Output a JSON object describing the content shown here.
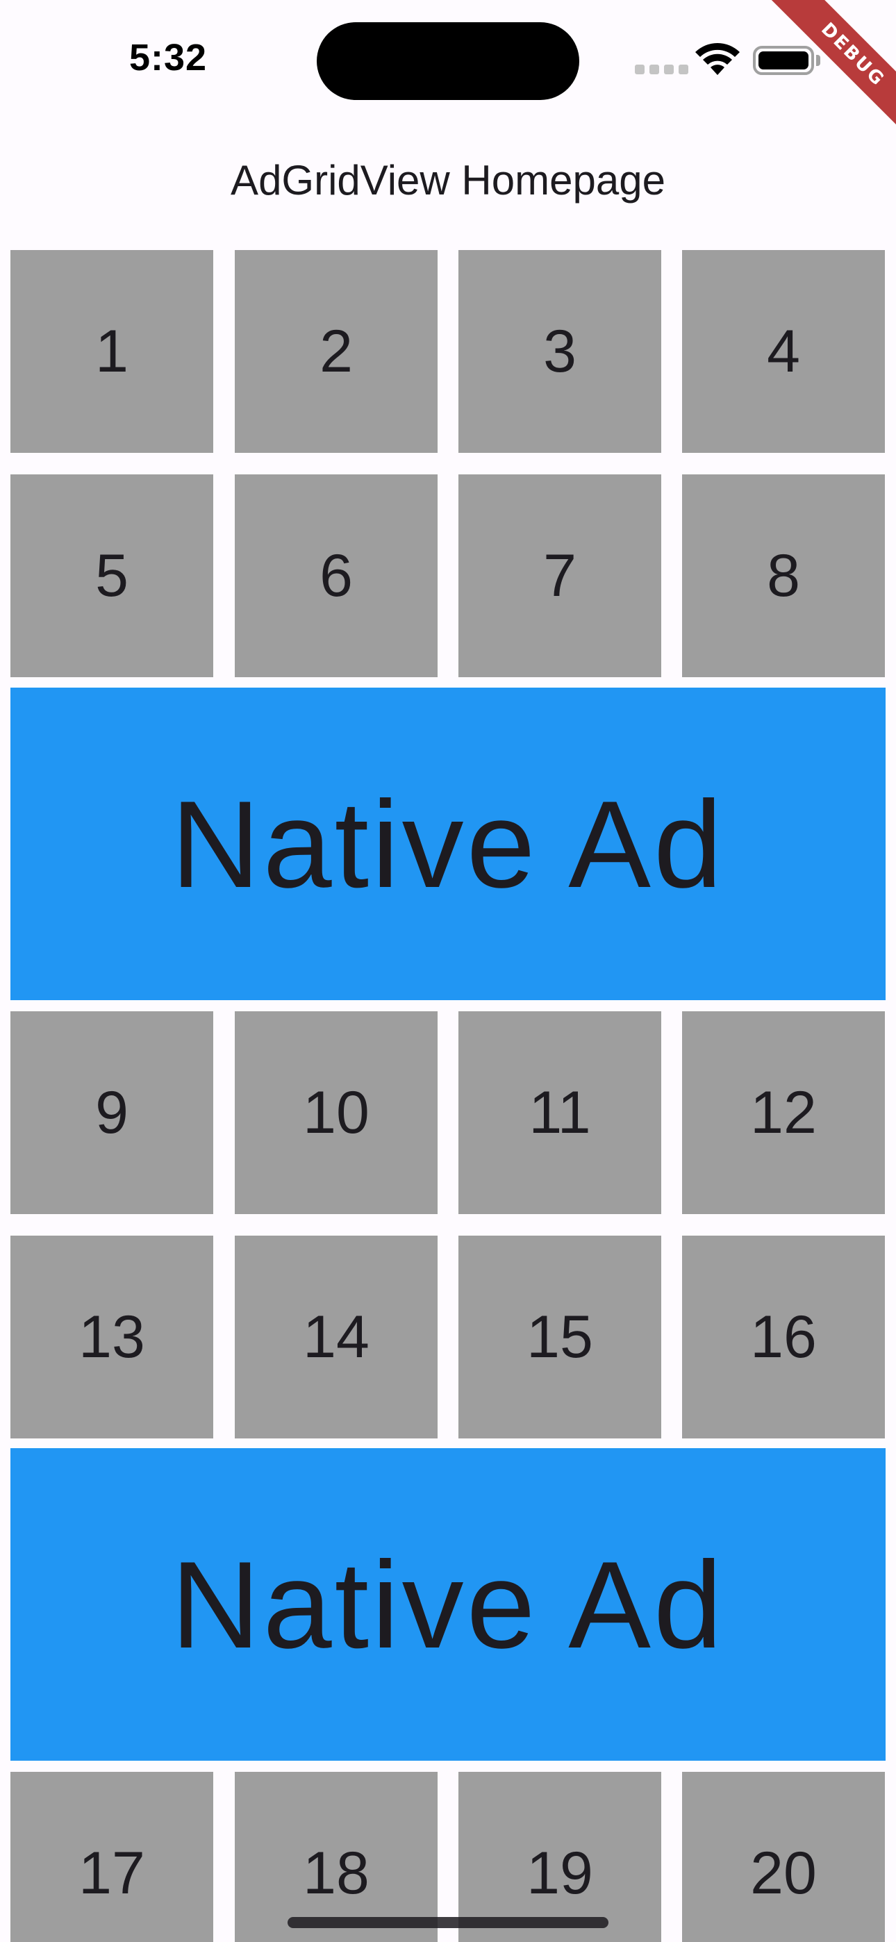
{
  "status_bar": {
    "time": "5:32",
    "icons": [
      "cellular-signal-icon",
      "wifi-icon",
      "battery-icon"
    ]
  },
  "debug_banner": "DEBUG",
  "app_bar": {
    "title": "AdGridView Homepage"
  },
  "grid": {
    "tile_color": "#9e9e9e",
    "ad_color": "#2196f3",
    "rows": [
      {
        "type": "tiles",
        "labels": [
          "1",
          "2",
          "3",
          "4"
        ]
      },
      {
        "type": "tiles",
        "labels": [
          "5",
          "6",
          "7",
          "8"
        ]
      },
      {
        "type": "ad",
        "label": "Native Ad"
      },
      {
        "type": "tiles",
        "labels": [
          "9",
          "10",
          "11",
          "12"
        ]
      },
      {
        "type": "tiles",
        "labels": [
          "13",
          "14",
          "15",
          "16"
        ]
      },
      {
        "type": "ad",
        "label": "Native Ad"
      },
      {
        "type": "tiles",
        "labels": [
          "17",
          "18",
          "19",
          "20"
        ]
      }
    ]
  }
}
